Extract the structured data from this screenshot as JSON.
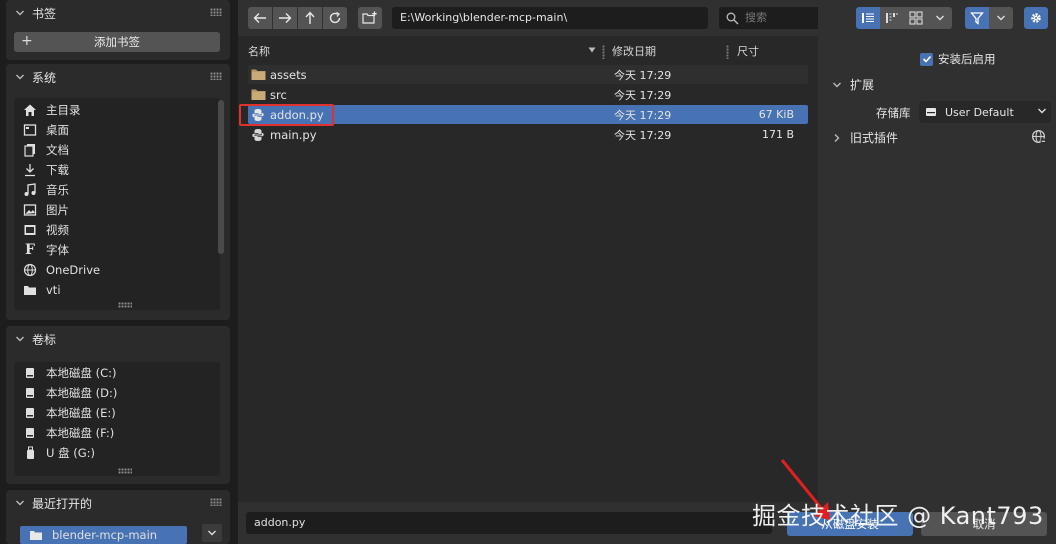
{
  "sidebar": {
    "bookmarks": {
      "title": "书签",
      "add_label": "添加书签"
    },
    "system": {
      "title": "系统",
      "items": [
        {
          "label": "主目录",
          "icon": "home-icon"
        },
        {
          "label": "桌面",
          "icon": "desktop-icon"
        },
        {
          "label": "文档",
          "icon": "documents-icon"
        },
        {
          "label": "下载",
          "icon": "download-icon"
        },
        {
          "label": "音乐",
          "icon": "music-icon"
        },
        {
          "label": "图片",
          "icon": "image-icon"
        },
        {
          "label": "视频",
          "icon": "video-icon"
        },
        {
          "label": "字体",
          "icon": "font-icon"
        },
        {
          "label": "OneDrive",
          "icon": "globe-icon"
        },
        {
          "label": "vti",
          "icon": "folder-icon"
        }
      ]
    },
    "volumes": {
      "title": "卷标",
      "items": [
        {
          "label": "本地磁盘 (C:)",
          "icon": "disk-icon"
        },
        {
          "label": "本地磁盘 (D:)",
          "icon": "disk-icon"
        },
        {
          "label": "本地磁盘 (E:)",
          "icon": "disk-icon"
        },
        {
          "label": "本地磁盘 (F:)",
          "icon": "disk-icon"
        },
        {
          "label": "U 盘 (G:)",
          "icon": "usb-icon"
        }
      ]
    },
    "recent": {
      "title": "最近打开的",
      "items": [
        {
          "label": "blender-mcp-main",
          "icon": "folder-icon"
        }
      ]
    }
  },
  "toolbar": {
    "path": "E:\\Working\\blender-mcp-main\\",
    "search_placeholder": "搜索"
  },
  "filelist": {
    "columns": {
      "name": "名称",
      "date": "修改日期",
      "size": "尺寸"
    },
    "rows": [
      {
        "name": "assets",
        "date": "今天 17:29",
        "size": "",
        "type": "folder"
      },
      {
        "name": "src",
        "date": "今天 17:29",
        "size": "",
        "type": "folder"
      },
      {
        "name": "addon.py",
        "date": "今天 17:29",
        "size": "67 KiB",
        "type": "python"
      },
      {
        "name": "main.py",
        "date": "今天 17:29",
        "size": "171 B",
        "type": "python"
      }
    ],
    "selected_index": 2
  },
  "bottom": {
    "filename": "addon.py",
    "install_label": "从磁盘安装",
    "cancel_label": "取消"
  },
  "rightpanel": {
    "enable_label": "安装后启用",
    "enable_checked": true,
    "extend_label": "扩展",
    "repo_label": "存储库",
    "repo_value": "User Default",
    "legacy_label": "旧式插件"
  },
  "watermark": "掘金技术社区 @ Kant793",
  "colors": {
    "accent": "#4772b3",
    "highlight_box": "#e03030"
  }
}
